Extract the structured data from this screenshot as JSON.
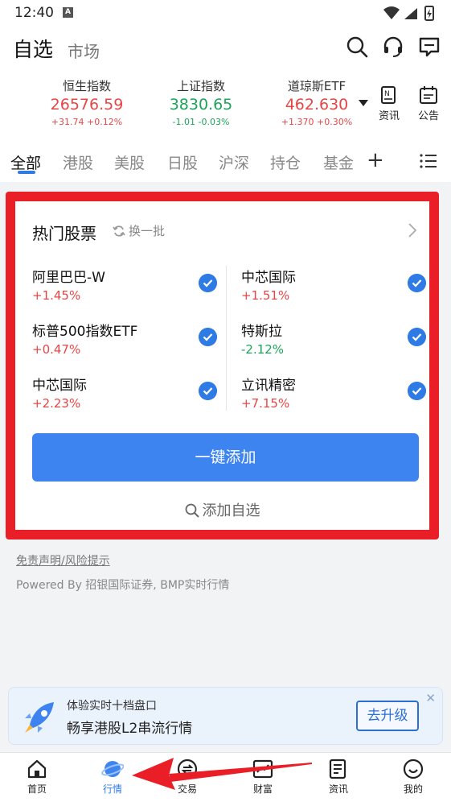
{
  "status": {
    "time": "12:40",
    "notif": "A"
  },
  "header": {
    "title": "自选",
    "subtitle": "市场"
  },
  "indices": [
    {
      "name": "恒生指数",
      "value": "26576.59",
      "change": "+31.74",
      "pct": "+0.12%"
    },
    {
      "name": "上证指数",
      "value": "3830.65",
      "change": "-1.01",
      "pct": "-0.03%"
    },
    {
      "name": "道琼斯ETF",
      "value": "462.630",
      "change": "+1.370",
      "pct": "+0.30%"
    }
  ],
  "index_actions": {
    "news": "资讯",
    "notice": "公告"
  },
  "tabs": [
    "全部",
    "港股",
    "美股",
    "日股",
    "沪深",
    "持仓",
    "基金"
  ],
  "hot": {
    "title": "热门股票",
    "refresh": "换一批",
    "stocks": [
      {
        "name": "阿里巴巴-W",
        "pct": "+1.45%"
      },
      {
        "name": "中芯国际",
        "pct": "+1.51%"
      },
      {
        "name": "标普500指数ETF",
        "pct": "+0.47%"
      },
      {
        "name": "特斯拉",
        "pct": "-2.12%"
      },
      {
        "name": "中芯国际",
        "pct": "+2.23%"
      },
      {
        "name": "立讯精密",
        "pct": "+7.15%"
      }
    ],
    "add_all": "一键添加",
    "add_self": "添加自选"
  },
  "footer": {
    "disclaimer": "免责声明/风险提示",
    "powered": "Powered By 招银国际证券, BMP实时行情"
  },
  "banner": {
    "line1": "体验实时十档盘口",
    "line2": "畅享港股L2串流行情",
    "button": "去升级",
    "close": "✕"
  },
  "nav": [
    "首页",
    "行情",
    "交易",
    "财富",
    "资讯",
    "我的"
  ],
  "colors": {
    "accent": "#2f7be6",
    "up": "#e84545",
    "down": "#1aa55a",
    "highlight": "#ea1e26"
  }
}
